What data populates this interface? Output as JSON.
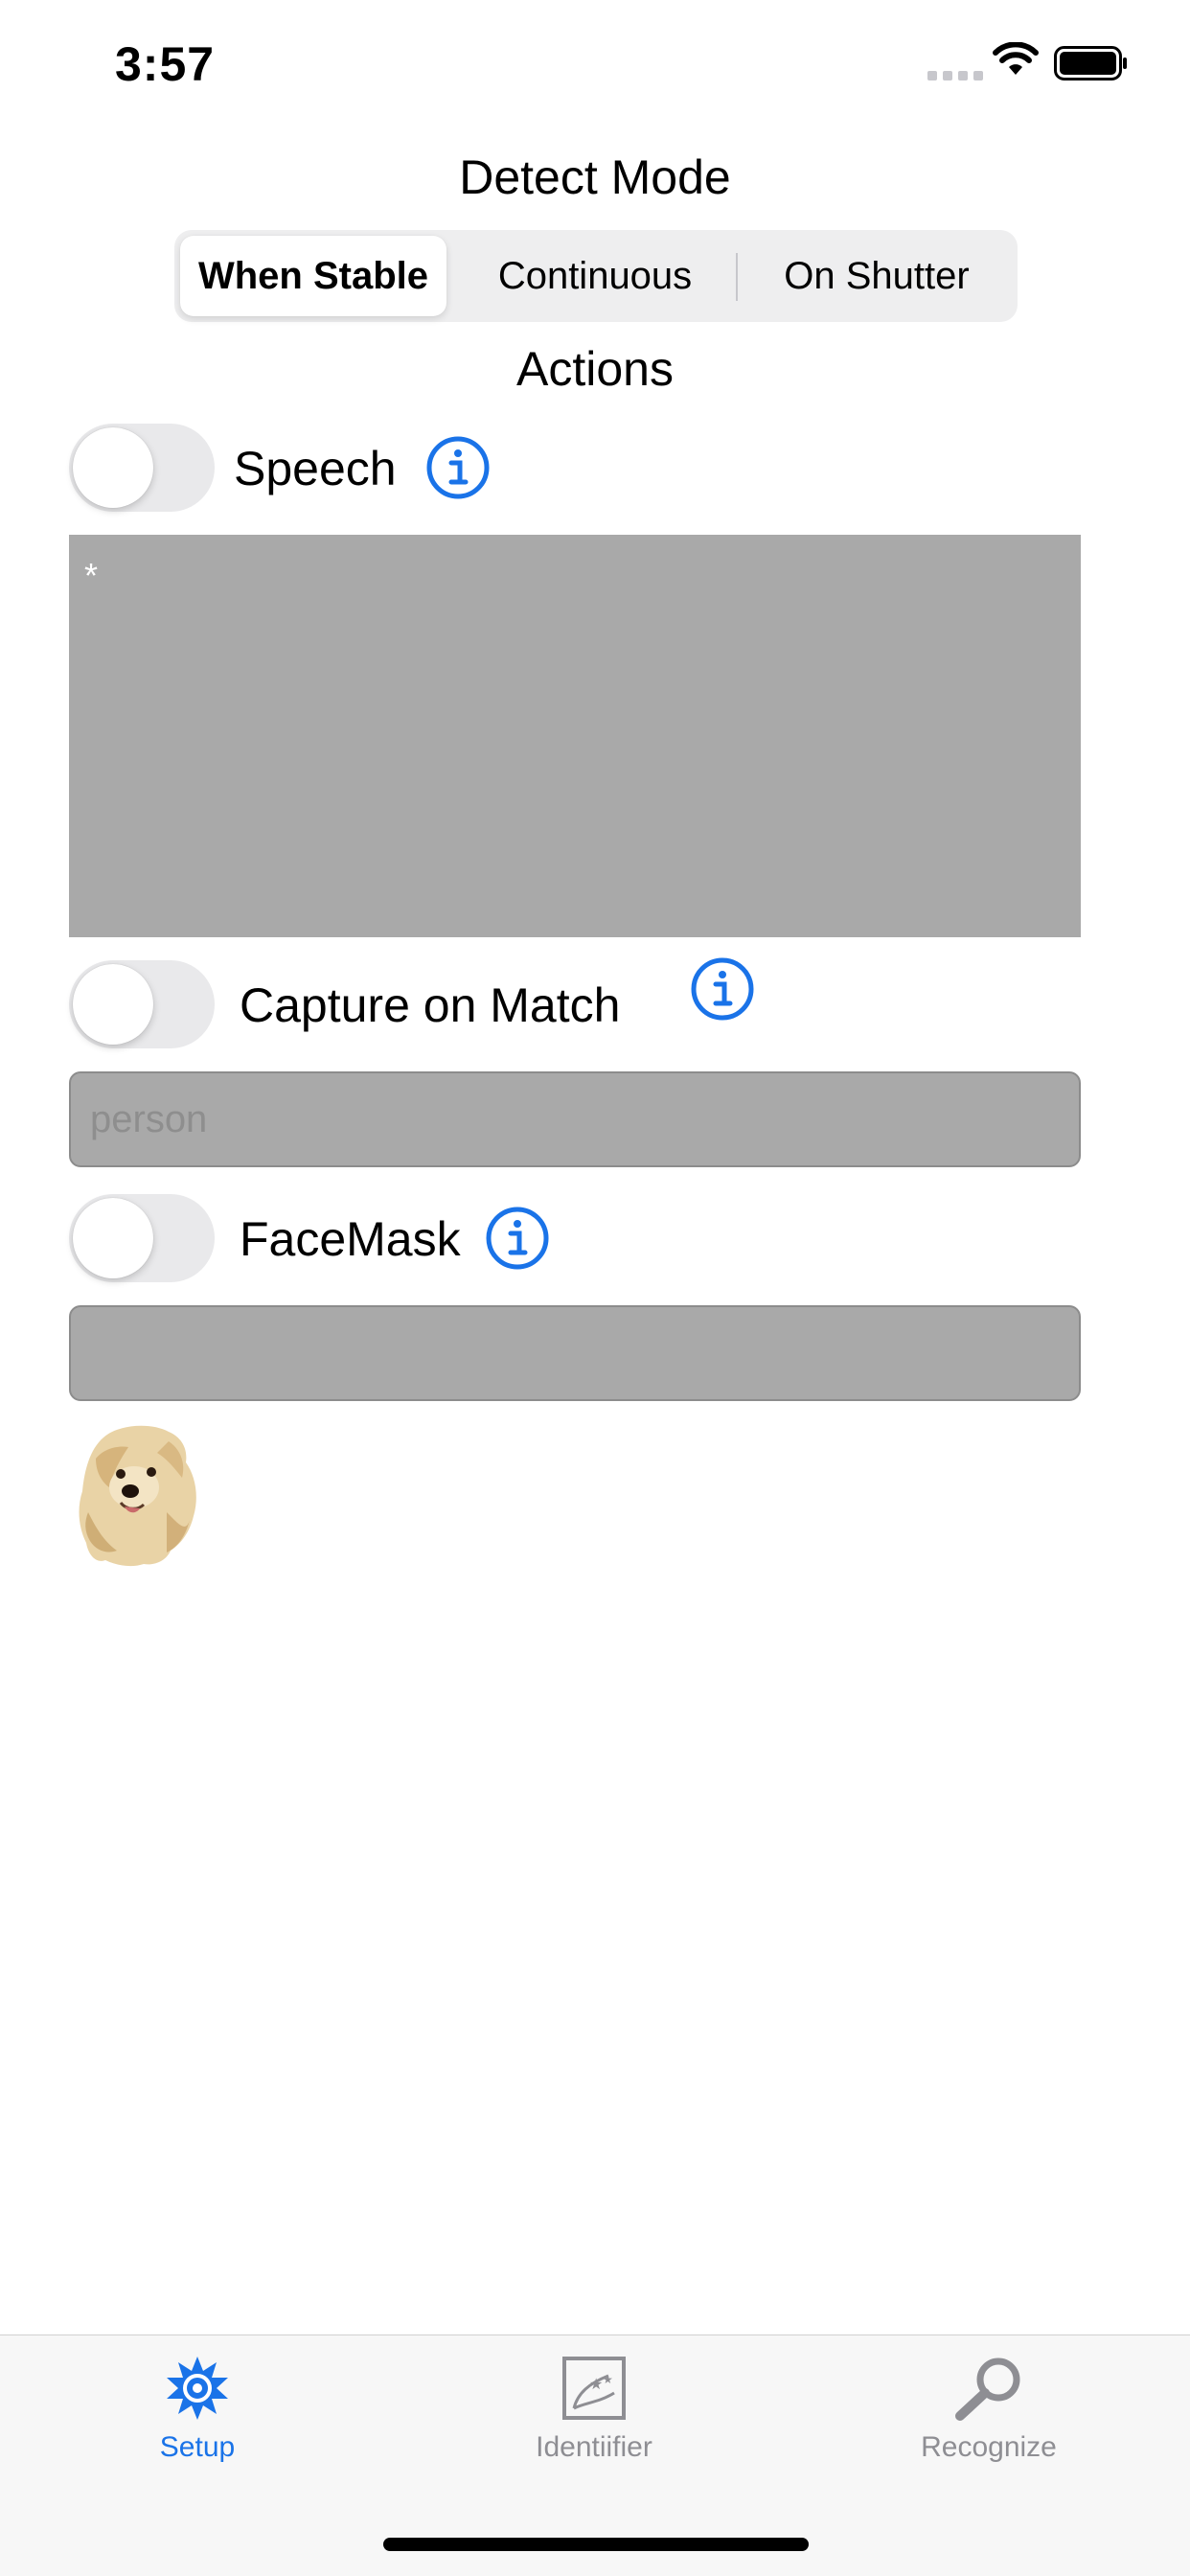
{
  "status_bar": {
    "time": "3:57"
  },
  "detect_mode": {
    "title": "Detect Mode",
    "options": [
      "When Stable",
      "Continuous",
      "On Shutter"
    ],
    "selected": "When Stable"
  },
  "actions": {
    "title": "Actions",
    "speech": {
      "label": "Speech",
      "enabled": false,
      "text": "*"
    },
    "capture": {
      "label": "Capture on Match",
      "enabled": false,
      "placeholder": "person"
    },
    "facemask": {
      "label": "FaceMask",
      "enabled": false,
      "value": ""
    }
  },
  "tab_bar": {
    "tabs": [
      {
        "label": "Setup",
        "icon": "gear-icon",
        "active": true
      },
      {
        "label": "Identiifier",
        "icon": "identifier-icon",
        "active": false
      },
      {
        "label": "Recognize",
        "icon": "magnifier-icon",
        "active": false
      }
    ]
  },
  "colors": {
    "accent": "#1a73e8",
    "field": "#a9a9a9",
    "inactive": "#8e8e93"
  }
}
